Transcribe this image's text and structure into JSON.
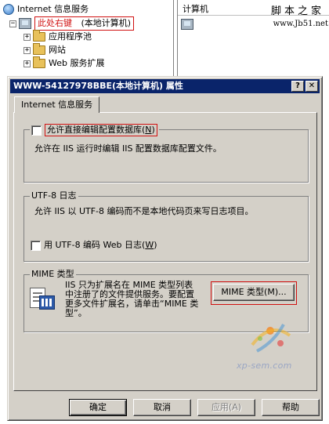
{
  "tree": {
    "root_label": "Internet 信息服务",
    "computer_label": "此处右键",
    "computer_suffix": "(本地计算机)",
    "items": [
      {
        "label": "应用程序池"
      },
      {
        "label": "网站"
      },
      {
        "label": "Web 服务扩展"
      }
    ]
  },
  "list": {
    "header": "计算机",
    "site_watermark": "脚本之家",
    "row_url": "www.Jb51.net"
  },
  "dialog": {
    "title": "WWW-54127978BBE(本地计算机) 属性",
    "help_label": "?",
    "close_label": "✕",
    "tab_label": "Internet 信息服务",
    "edit_group": {
      "checkbox_label": "允许直接编辑配置数据库(",
      "checkbox_key": "N",
      "description": "允许在 IIS 运行时编辑 IIS 配置数据库配置文件。"
    },
    "utf8_group": {
      "title": "UTF-8 日志",
      "description": "允许 IIS 以 UTF-8 编码而不是本地代码页来写日志项目。",
      "checkbox_label": "用 UTF-8 编码 Web 日志(",
      "checkbox_key": "W"
    },
    "mime_group": {
      "title": "MIME 类型",
      "description_lines": [
        "IIS 只为扩展名在 MIME 类型列表",
        "中注册了的文件提供服务。要配置",
        "更多文件扩展名，请单击“MIME 类",
        "型”。"
      ],
      "button_label": "MIME 类型(M)..."
    },
    "buttons": {
      "ok": "确定",
      "cancel": "取消",
      "apply": "应用(A)",
      "help": "帮助"
    }
  },
  "watermark": {
    "logo_text": "xp-sem.com"
  }
}
